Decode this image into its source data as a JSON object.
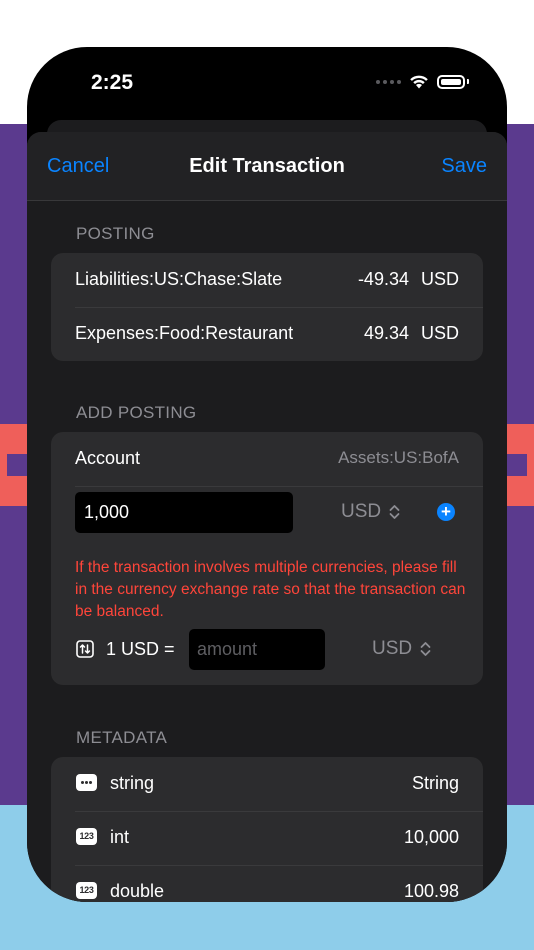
{
  "status": {
    "time": "2:25"
  },
  "nav": {
    "cancel": "Cancel",
    "title": "Edit Transaction",
    "save": "Save"
  },
  "posting": {
    "header": "POSTING",
    "rows": [
      {
        "account": "Liabilities:US:Chase:Slate",
        "amount": "-49.34",
        "currency": "USD"
      },
      {
        "account": "Expenses:Food:Restaurant",
        "amount": "49.34",
        "currency": "USD"
      }
    ]
  },
  "add_posting": {
    "header": "ADD POSTING",
    "account_label": "Account",
    "account_value": "Assets:US:BofA",
    "amount_value": "1,000",
    "currency": "USD",
    "warning": "If the transaction involves multiple currencies, please fill in the currency exchange rate so that the transaction can be balanced.",
    "rate_label": "1 USD =",
    "rate_placeholder": "amount",
    "rate_currency": "USD"
  },
  "metadata": {
    "header": "METADATA",
    "rows": [
      {
        "icon": "ellipsis-icon",
        "key": "string",
        "value": "String"
      },
      {
        "icon": "number-123-icon",
        "key": "int",
        "value": "10,000"
      },
      {
        "icon": "number-123-icon",
        "key": "double",
        "value": "100.98"
      }
    ],
    "number_icon_text": "123"
  },
  "colors": {
    "accent": "#0a84ff",
    "warning": "#ff453a",
    "background_purple": "#5b3a8e",
    "background_blue": "#8ecdea",
    "background_red": "#ef5f5a"
  }
}
